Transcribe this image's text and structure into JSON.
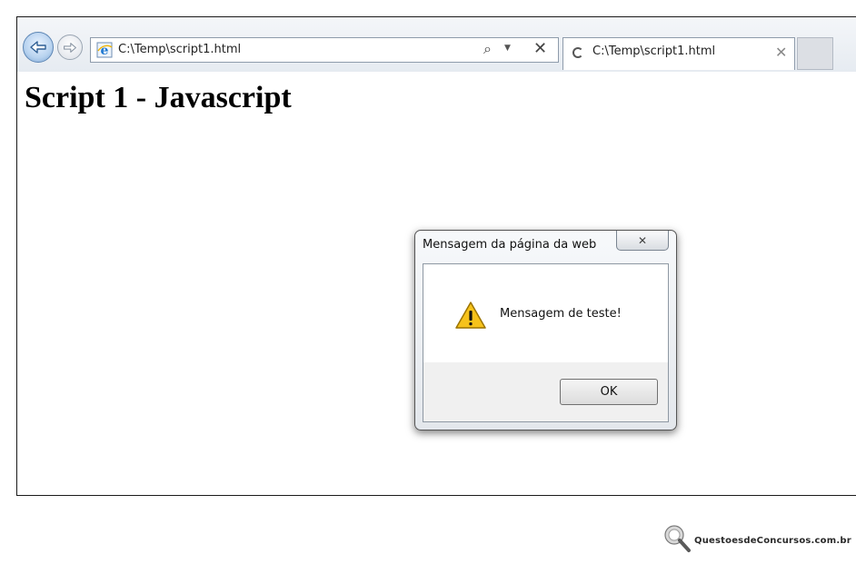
{
  "browser": {
    "address_url": "C:\\Temp\\script1.html",
    "tab_title": "C:\\Temp\\script1.html",
    "icons": {
      "back": "back-arrow-icon",
      "forward": "forward-arrow-icon",
      "page": "ie-page-icon",
      "search": "search-icon",
      "dropdown": "dropdown-arrow-icon",
      "stop": "stop-icon",
      "loading": "loading-spinner-icon",
      "tab_close": "close-icon"
    }
  },
  "page": {
    "heading": "Script 1 - Javascript"
  },
  "dialog": {
    "title": "Mensagem da página da web",
    "message": "Mensagem de teste!",
    "ok_label": "OK",
    "icon": "warning-icon",
    "close_icon": "close-icon"
  },
  "watermark": {
    "text": "QuestoesdeConcursos.com.br"
  },
  "colors": {
    "accent_blue": "#5d86b5",
    "warning_yellow": "#f6c21b"
  }
}
